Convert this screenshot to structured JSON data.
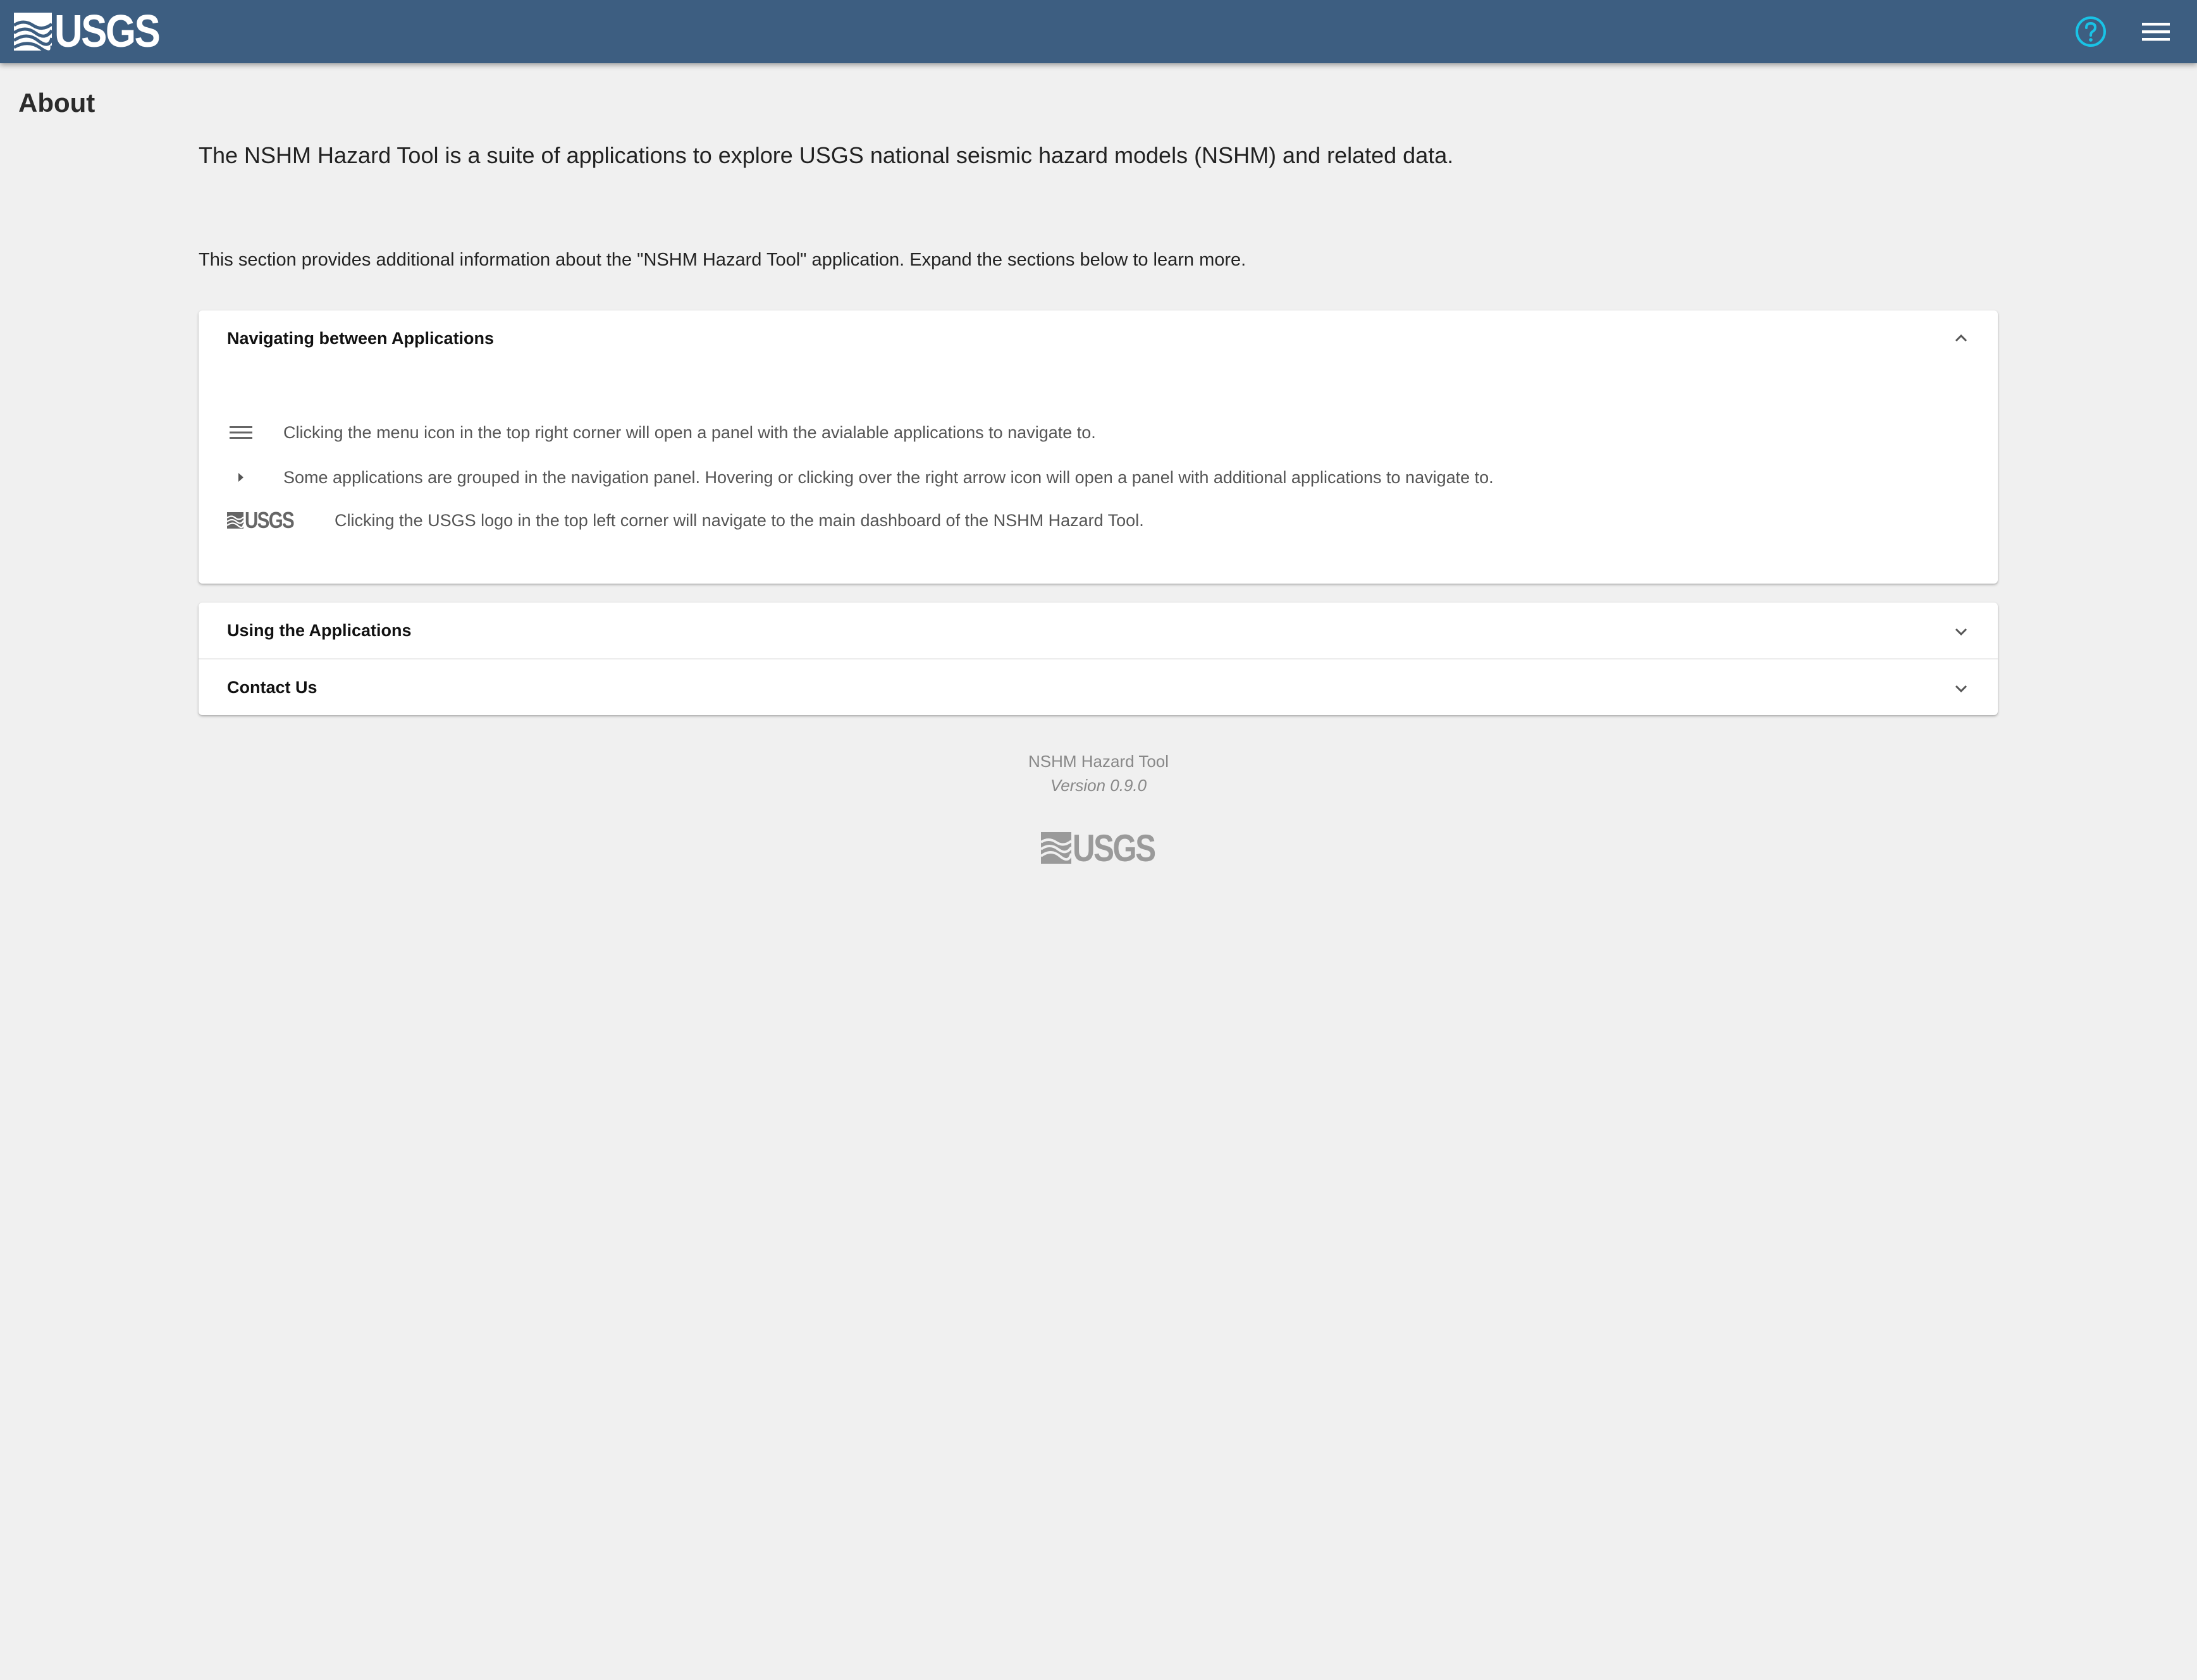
{
  "header": {
    "logo_text": "USGS",
    "icons": {
      "help": "help-circle-icon",
      "menu": "hamburger-menu-icon"
    },
    "colors": {
      "bar": "#3d5e81",
      "help_icon": "#19c3e6"
    }
  },
  "page": {
    "title": "About",
    "intro": "The NSHM Hazard Tool is a suite of applications to explore USGS national seismic hazard models (NSHM) and related data.",
    "description": "This section provides additional information about the \"NSHM Hazard Tool\" application. Expand the sections below to learn more."
  },
  "panels": [
    {
      "title": "Navigating between Applications",
      "expanded": true,
      "items": [
        {
          "icon": "hamburger-menu-icon",
          "text": "Clicking the menu icon in the top right corner will open a panel with the avialable applications to navigate to."
        },
        {
          "icon": "caret-right-icon",
          "text": "Some applications are grouped in the navigation panel. Hovering or clicking over the right arrow icon will open a panel with additional applications to navigate to."
        },
        {
          "icon": "usgs-logo",
          "logo_text": "USGS",
          "text": "Clicking the USGS logo in the top left corner will navigate to the main dashboard of the NSHM Hazard Tool."
        }
      ]
    },
    {
      "title": "Using the Applications",
      "expanded": false
    },
    {
      "title": "Contact Us",
      "expanded": false
    }
  ],
  "footer": {
    "name": "NSHM Hazard Tool",
    "version": "Version 0.9.0",
    "logo_text": "USGS"
  }
}
